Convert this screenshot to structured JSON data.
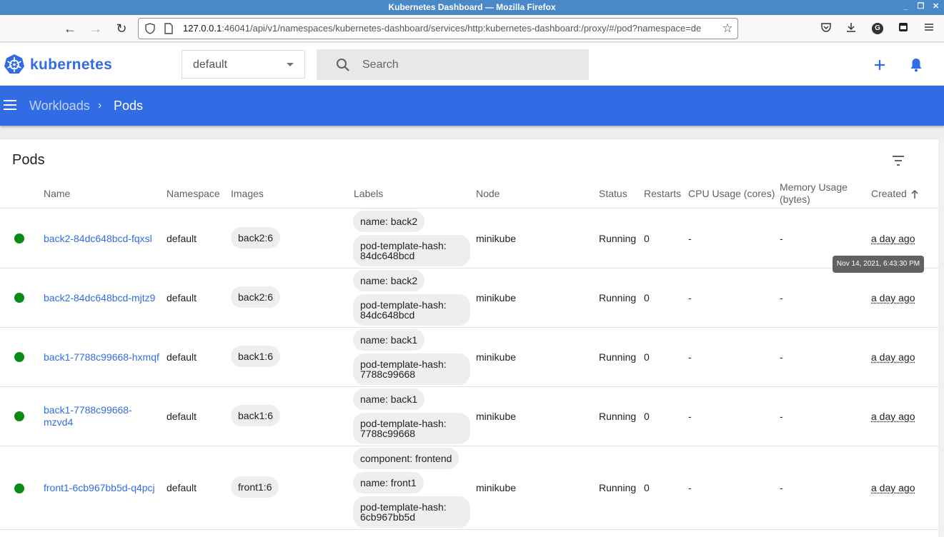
{
  "window": {
    "title": "Kubernetes Dashboard — Mozilla Firefox"
  },
  "browser": {
    "url_host": "127.0.0.1",
    "url_rest": ":46041/api/v1/namespaces/kubernetes-dashboard/services/http:kubernetes-dashboard:/proxy/#/pod?namespace=de"
  },
  "header": {
    "brand": "kubernetes",
    "namespace": "default",
    "search_placeholder": "Search"
  },
  "breadcrumb": {
    "parent": "Workloads",
    "current": "Pods"
  },
  "card": {
    "title": "Pods"
  },
  "columns": {
    "name": "Name",
    "namespace": "Namespace",
    "images": "Images",
    "labels": "Labels",
    "node": "Node",
    "status": "Status",
    "restarts": "Restarts",
    "cpu": "CPU Usage (cores)",
    "memory": "Memory Usage (bytes)",
    "created": "Created"
  },
  "pods": [
    {
      "name": "back2-84dc648bcd-fqxsl",
      "namespace": "default",
      "image": "back2:6",
      "labels": [
        "name: back2",
        "pod-template-hash: 84dc648bcd"
      ],
      "node": "minikube",
      "status": "Running",
      "restarts": "0",
      "cpu": "-",
      "memory": "-",
      "created": "a day ago"
    },
    {
      "name": "back2-84dc648bcd-mjtz9",
      "namespace": "default",
      "image": "back2:6",
      "labels": [
        "name: back2",
        "pod-template-hash: 84dc648bcd"
      ],
      "node": "minikube",
      "status": "Running",
      "restarts": "0",
      "cpu": "-",
      "memory": "-",
      "created": "a day ago"
    },
    {
      "name": "back1-7788c99668-hxmqf",
      "namespace": "default",
      "image": "back1:6",
      "labels": [
        "name: back1",
        "pod-template-hash: 7788c99668"
      ],
      "node": "minikube",
      "status": "Running",
      "restarts": "0",
      "cpu": "-",
      "memory": "-",
      "created": "a day ago"
    },
    {
      "name": "back1-7788c99668-mzvd4",
      "namespace": "default",
      "image": "back1:6",
      "labels": [
        "name: back1",
        "pod-template-hash: 7788c99668"
      ],
      "node": "minikube",
      "status": "Running",
      "restarts": "0",
      "cpu": "-",
      "memory": "-",
      "created": "a day ago"
    },
    {
      "name": "front1-6cb967bb5d-q4pcj",
      "namespace": "default",
      "image": "front1:6",
      "labels": [
        "component: frontend",
        "name: front1",
        "pod-template-hash: 6cb967bb5d"
      ],
      "node": "minikube",
      "status": "Running",
      "restarts": "0",
      "cpu": "-",
      "memory": "-",
      "created": "a day ago"
    }
  ],
  "tooltip": "Nov 14, 2021, 6:43:30 PM",
  "colors": {
    "brand": "#326ce5",
    "running": "#0a8a16"
  }
}
